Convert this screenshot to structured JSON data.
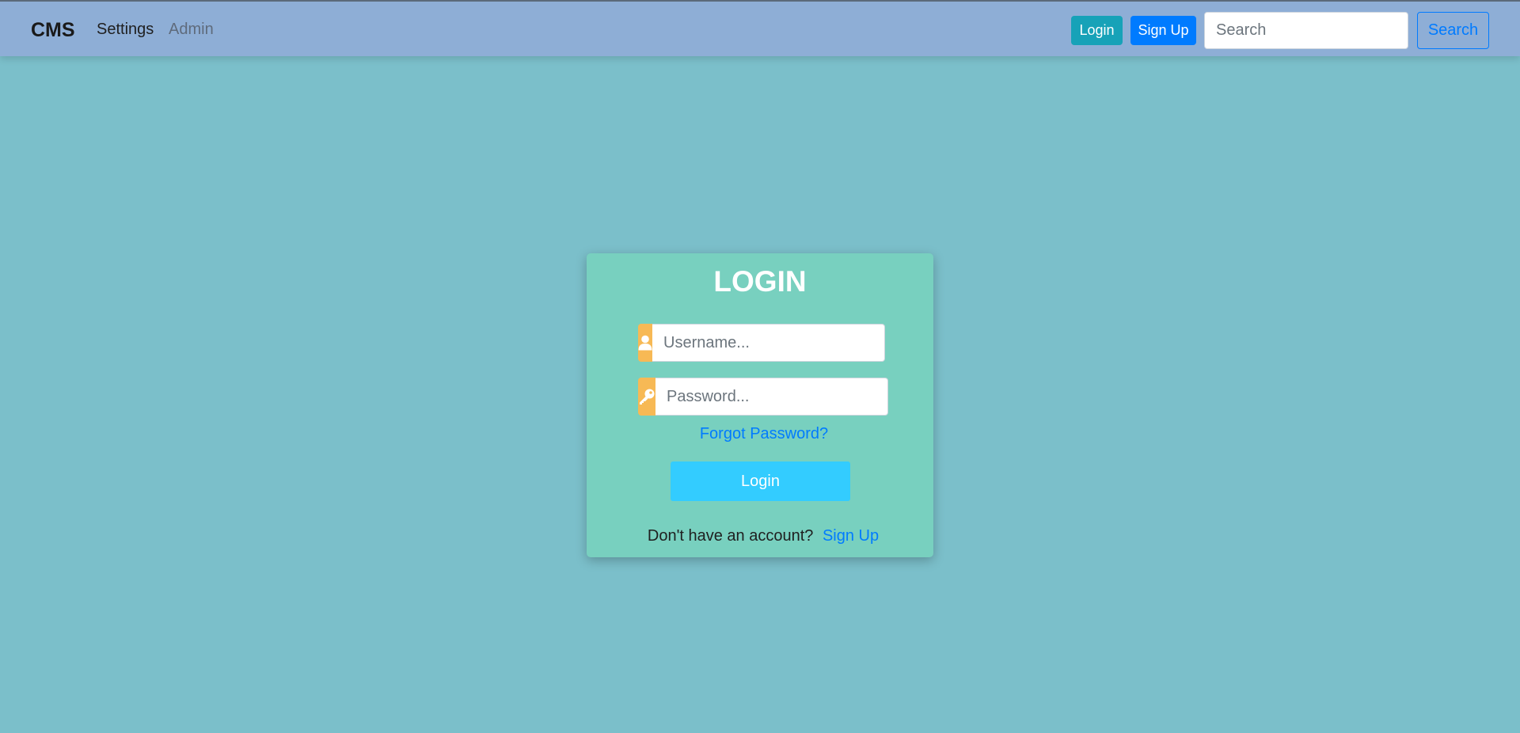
{
  "navbar": {
    "brand": "CMS",
    "links": [
      "Settings",
      "Admin"
    ],
    "login_label": "Login",
    "signup_label": "Sign Up",
    "search_placeholder": "Search",
    "search_button": "Search"
  },
  "login_card": {
    "title": "LOGIN",
    "username_placeholder": "Username...",
    "password_placeholder": "Password...",
    "forgot_password": "Forgot Password?",
    "login_button": "Login",
    "no_account_text": "Don't have an account?",
    "signup_link": "Sign Up",
    "icons": {
      "username": "user-icon",
      "password": "key-icon"
    }
  },
  "colors": {
    "page_background": "#7bbfca",
    "navbar_background": "#8eaed6",
    "card_background": "#78d0bf",
    "addon": "#f7b955",
    "primary": "#007bff",
    "info": "#17a2b8",
    "login_button": "#33ccff"
  }
}
